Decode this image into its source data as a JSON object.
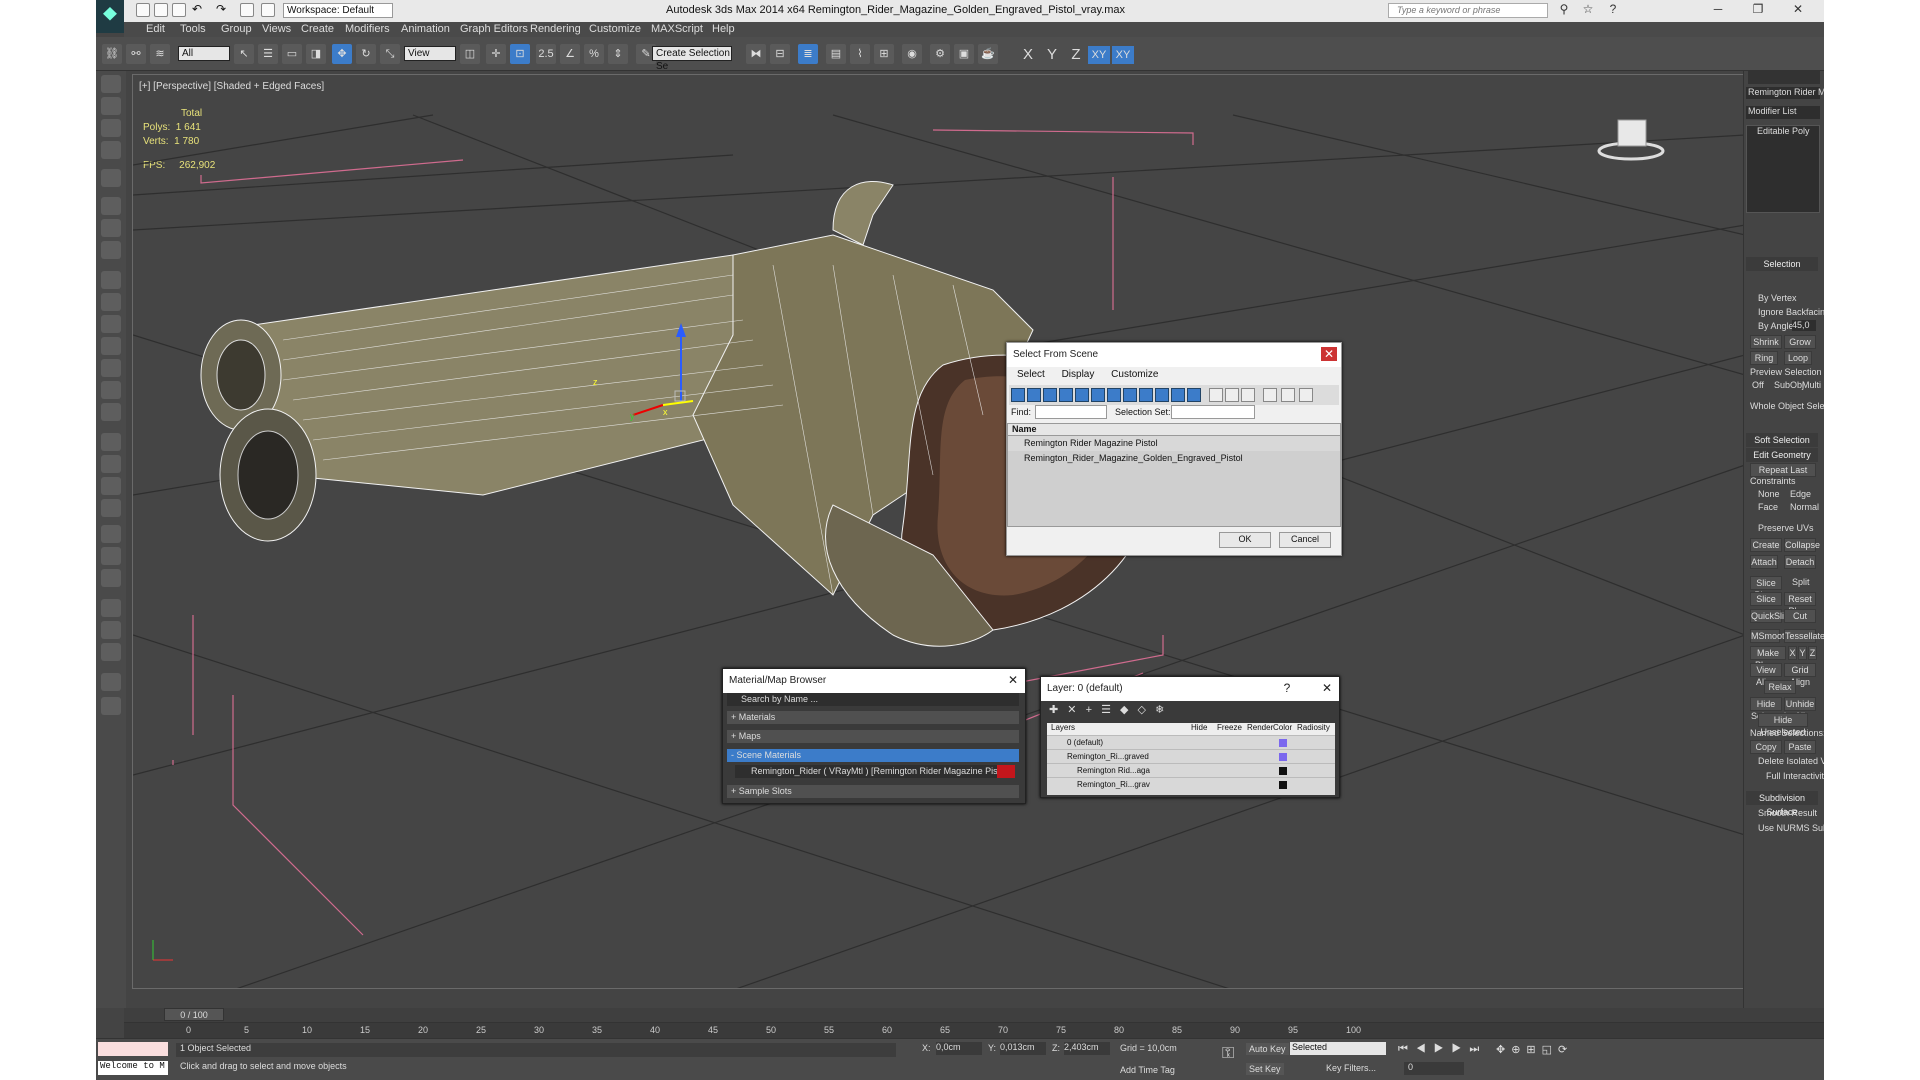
{
  "title_bar": {
    "workspace": "Workspace: Default",
    "app_title": "Autodesk 3ds Max  2014 x64     Remington_Rider_Magazine_Golden_Engraved_Pistol_vray.max",
    "search_placeholder": "Type a keyword or phrase"
  },
  "menu": [
    "Edit",
    "Tools",
    "Group",
    "Views",
    "Create",
    "Modifiers",
    "Animation",
    "Graph Editors",
    "Rendering",
    "Customize",
    "MAXScript",
    "Help"
  ],
  "toolbar": {
    "filter_value": "All",
    "ref_coord": "View",
    "selection_set": "Create Selection Se",
    "snap_label": "2.5",
    "axes": [
      "X",
      "Y",
      "Z",
      "XY",
      "XY"
    ]
  },
  "viewport": {
    "label": "[+] [Perspective] [Shaded + Edged Faces]",
    "stats": {
      "total_label": "Total",
      "polys_label": "Polys:",
      "polys": "1 641",
      "verts_label": "Verts:",
      "verts": "1 780",
      "fps_label": "FPS:",
      "fps": "262,902"
    },
    "gizmo": {
      "x": "x",
      "y": "y",
      "z": "z"
    }
  },
  "select_from_scene": {
    "title": "Select From Scene",
    "menus": [
      "Select",
      "Display",
      "Customize"
    ],
    "find_label": "Find:",
    "selset_label": "Selection Set:",
    "col_name": "Name",
    "items": [
      "Remington Rider Magazine Pistol",
      "Remington_Rider_Magazine_Golden_Engraved_Pistol"
    ],
    "ok": "OK",
    "cancel": "Cancel"
  },
  "material_browser": {
    "title": "Material/Map Browser",
    "search_placeholder": "Search by Name ...",
    "sections": {
      "materials": "+ Materials",
      "maps": "+ Maps",
      "scene": "- Scene Materials",
      "samples": "+ Sample Slots"
    },
    "scene_material": "Remington_Rider  ( VRayMtl ) [Remington Rider Magazine Pistol]",
    "swatch_color": "#c4161c"
  },
  "layer_dialog": {
    "title": "Layer: 0 (default)",
    "help": "?",
    "columns": [
      "Layers",
      "Hide",
      "Freeze",
      "Render",
      "Color",
      "Radiosity"
    ],
    "rows": [
      {
        "name": "0 (default)",
        "color": "#7b68ee"
      },
      {
        "name": "Remington_Ri...graved",
        "color": "#7b68ee"
      },
      {
        "name": "Remington Rid...aga",
        "color": "#111111"
      },
      {
        "name": "Remington_Ri...grav",
        "color": "#111111"
      }
    ]
  },
  "command_panel": {
    "object_name": "Remington Rider Magazine Pis",
    "modifier_list": "Modifier List",
    "stack_item": "Editable Poly",
    "selection": {
      "title": "Selection",
      "by_vertex": "By Vertex",
      "ignore_backfacing": "Ignore Backfacing",
      "by_angle": "By Angle:",
      "angle": "45,0",
      "shrink": "Shrink",
      "grow": "Grow",
      "ring": "Ring",
      "loop": "Loop",
      "preview": "Preview Selection",
      "off": "Off",
      "subobj": "SubObj",
      "multi": "Multi",
      "whole": "Whole Object Selected"
    },
    "soft_selection": "Soft Selection",
    "edit_geometry": {
      "title": "Edit Geometry",
      "repeat_last": "Repeat Last",
      "constraints": "Constraints",
      "none": "None",
      "edge": "Edge",
      "face": "Face",
      "normal": "Normal",
      "preserve_uvs": "Preserve UVs",
      "create": "Create",
      "collapse": "Collapse",
      "attach": "Attach",
      "detach": "Detach",
      "slice_plane": "Slice Plane",
      "split": "Split",
      "slice": "Slice",
      "reset_plane": "Reset Plane",
      "quickslice": "QuickSlice",
      "cut": "Cut",
      "msmooth": "MSmooth",
      "tessellate": "Tessellate",
      "make_planar": "Make Planar",
      "x": "X",
      "y": "Y",
      "z": "Z",
      "view_align": "View Align",
      "grid_align": "Grid Align",
      "relax": "Relax",
      "hide_selected": "Hide Selected",
      "unhide_all": "Unhide All",
      "hide_unselected": "Hide Unselected",
      "named_selections": "Named Selections:",
      "copy": "Copy",
      "paste": "Paste",
      "delete_isolated": "Delete Isolated Vertices",
      "full_interactivity": "Full Interactivity"
    },
    "subdivision": {
      "title": "Subdivision Surface",
      "smooth_result": "Smooth Result",
      "use_nurms": "Use NURMS Subdivision"
    }
  },
  "timeline": {
    "frame": "0 / 100",
    "ticks": [
      "0",
      "5",
      "10",
      "15",
      "20",
      "25",
      "30",
      "35",
      "40",
      "45",
      "50",
      "55",
      "60",
      "65",
      "70",
      "75",
      "80",
      "85",
      "90",
      "95",
      "100"
    ]
  },
  "status": {
    "maxscript": "Welcome to M",
    "selected": "1 Object Selected",
    "prompt": "Click and drag to select and move objects",
    "x_label": "X:",
    "x": "0,0cm",
    "y_label": "Y:",
    "y": "0,013cm",
    "z_label": "Z:",
    "z": "2,403cm",
    "grid": "Grid = 10,0cm",
    "add_time_tag": "Add Time Tag",
    "auto_key": "Auto Key",
    "set_key": "Set Key",
    "key_mode": "Selected",
    "key_filters": "Key Filters...",
    "frame_field": "0"
  }
}
